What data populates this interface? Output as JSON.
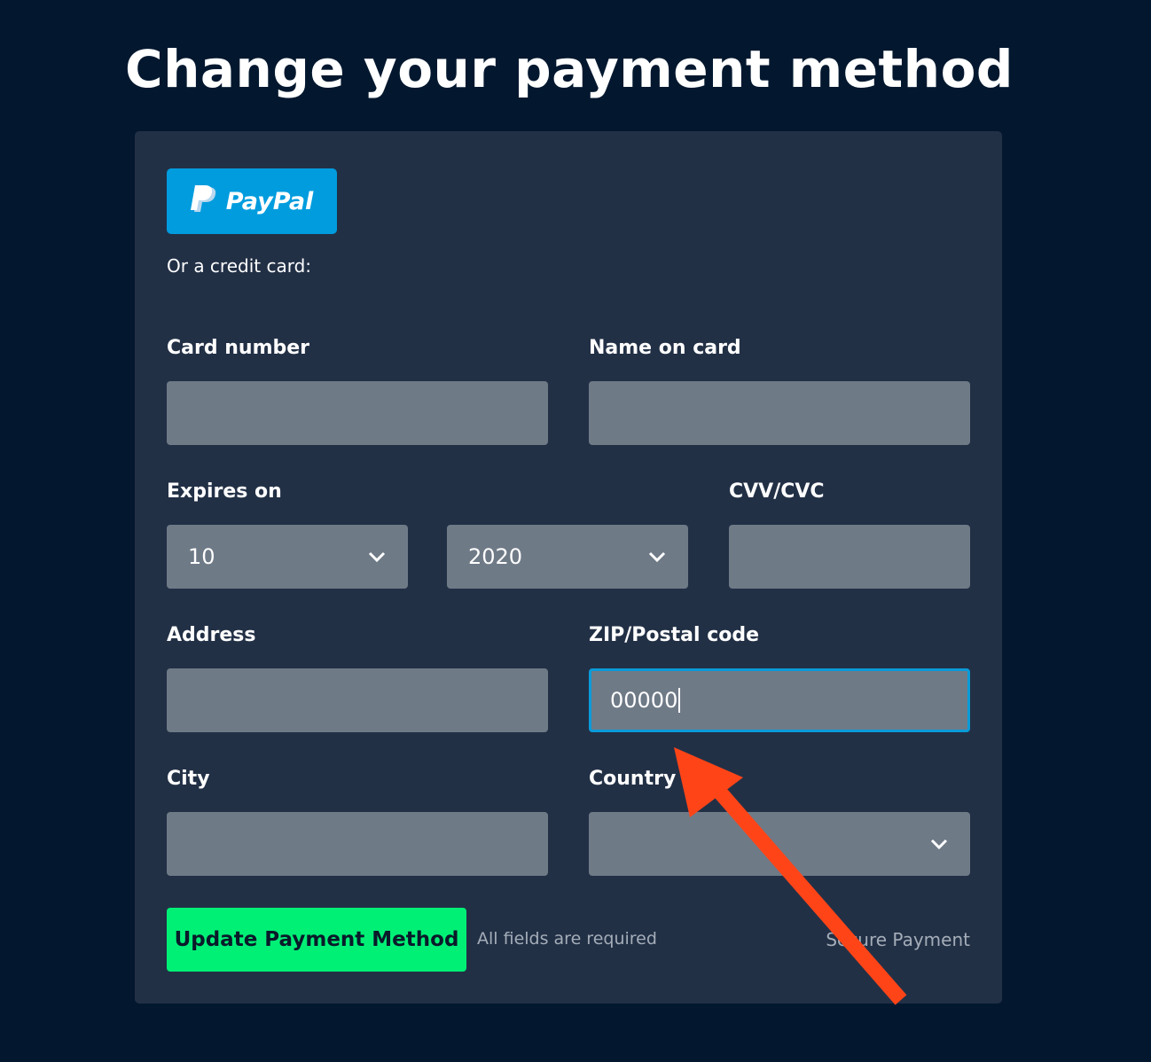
{
  "page": {
    "title": "Change your payment method"
  },
  "paypal": {
    "label": "PayPal",
    "brand_color": "#009cde"
  },
  "form": {
    "or_text": "Or a credit card:",
    "card_number": {
      "label": "Card number",
      "value": ""
    },
    "name_on_card": {
      "label": "Name on card",
      "value": ""
    },
    "expires": {
      "label": "Expires on",
      "month": {
        "value": "10"
      },
      "year": {
        "value": "2020"
      }
    },
    "cvv": {
      "label": "CVV/CVC",
      "value": ""
    },
    "address": {
      "label": "Address",
      "value": ""
    },
    "zip": {
      "label": "ZIP/Postal code",
      "value": "00000"
    },
    "city": {
      "label": "City",
      "value": ""
    },
    "country": {
      "label": "Country",
      "value": ""
    }
  },
  "footer": {
    "update_button": "Update Payment Method",
    "required_note": "All fields are required",
    "secure_note": "Secure Payment",
    "button_color": "#00f076"
  },
  "annotation": {
    "arrow_color": "#ff4518",
    "points_to": "zip-field"
  }
}
